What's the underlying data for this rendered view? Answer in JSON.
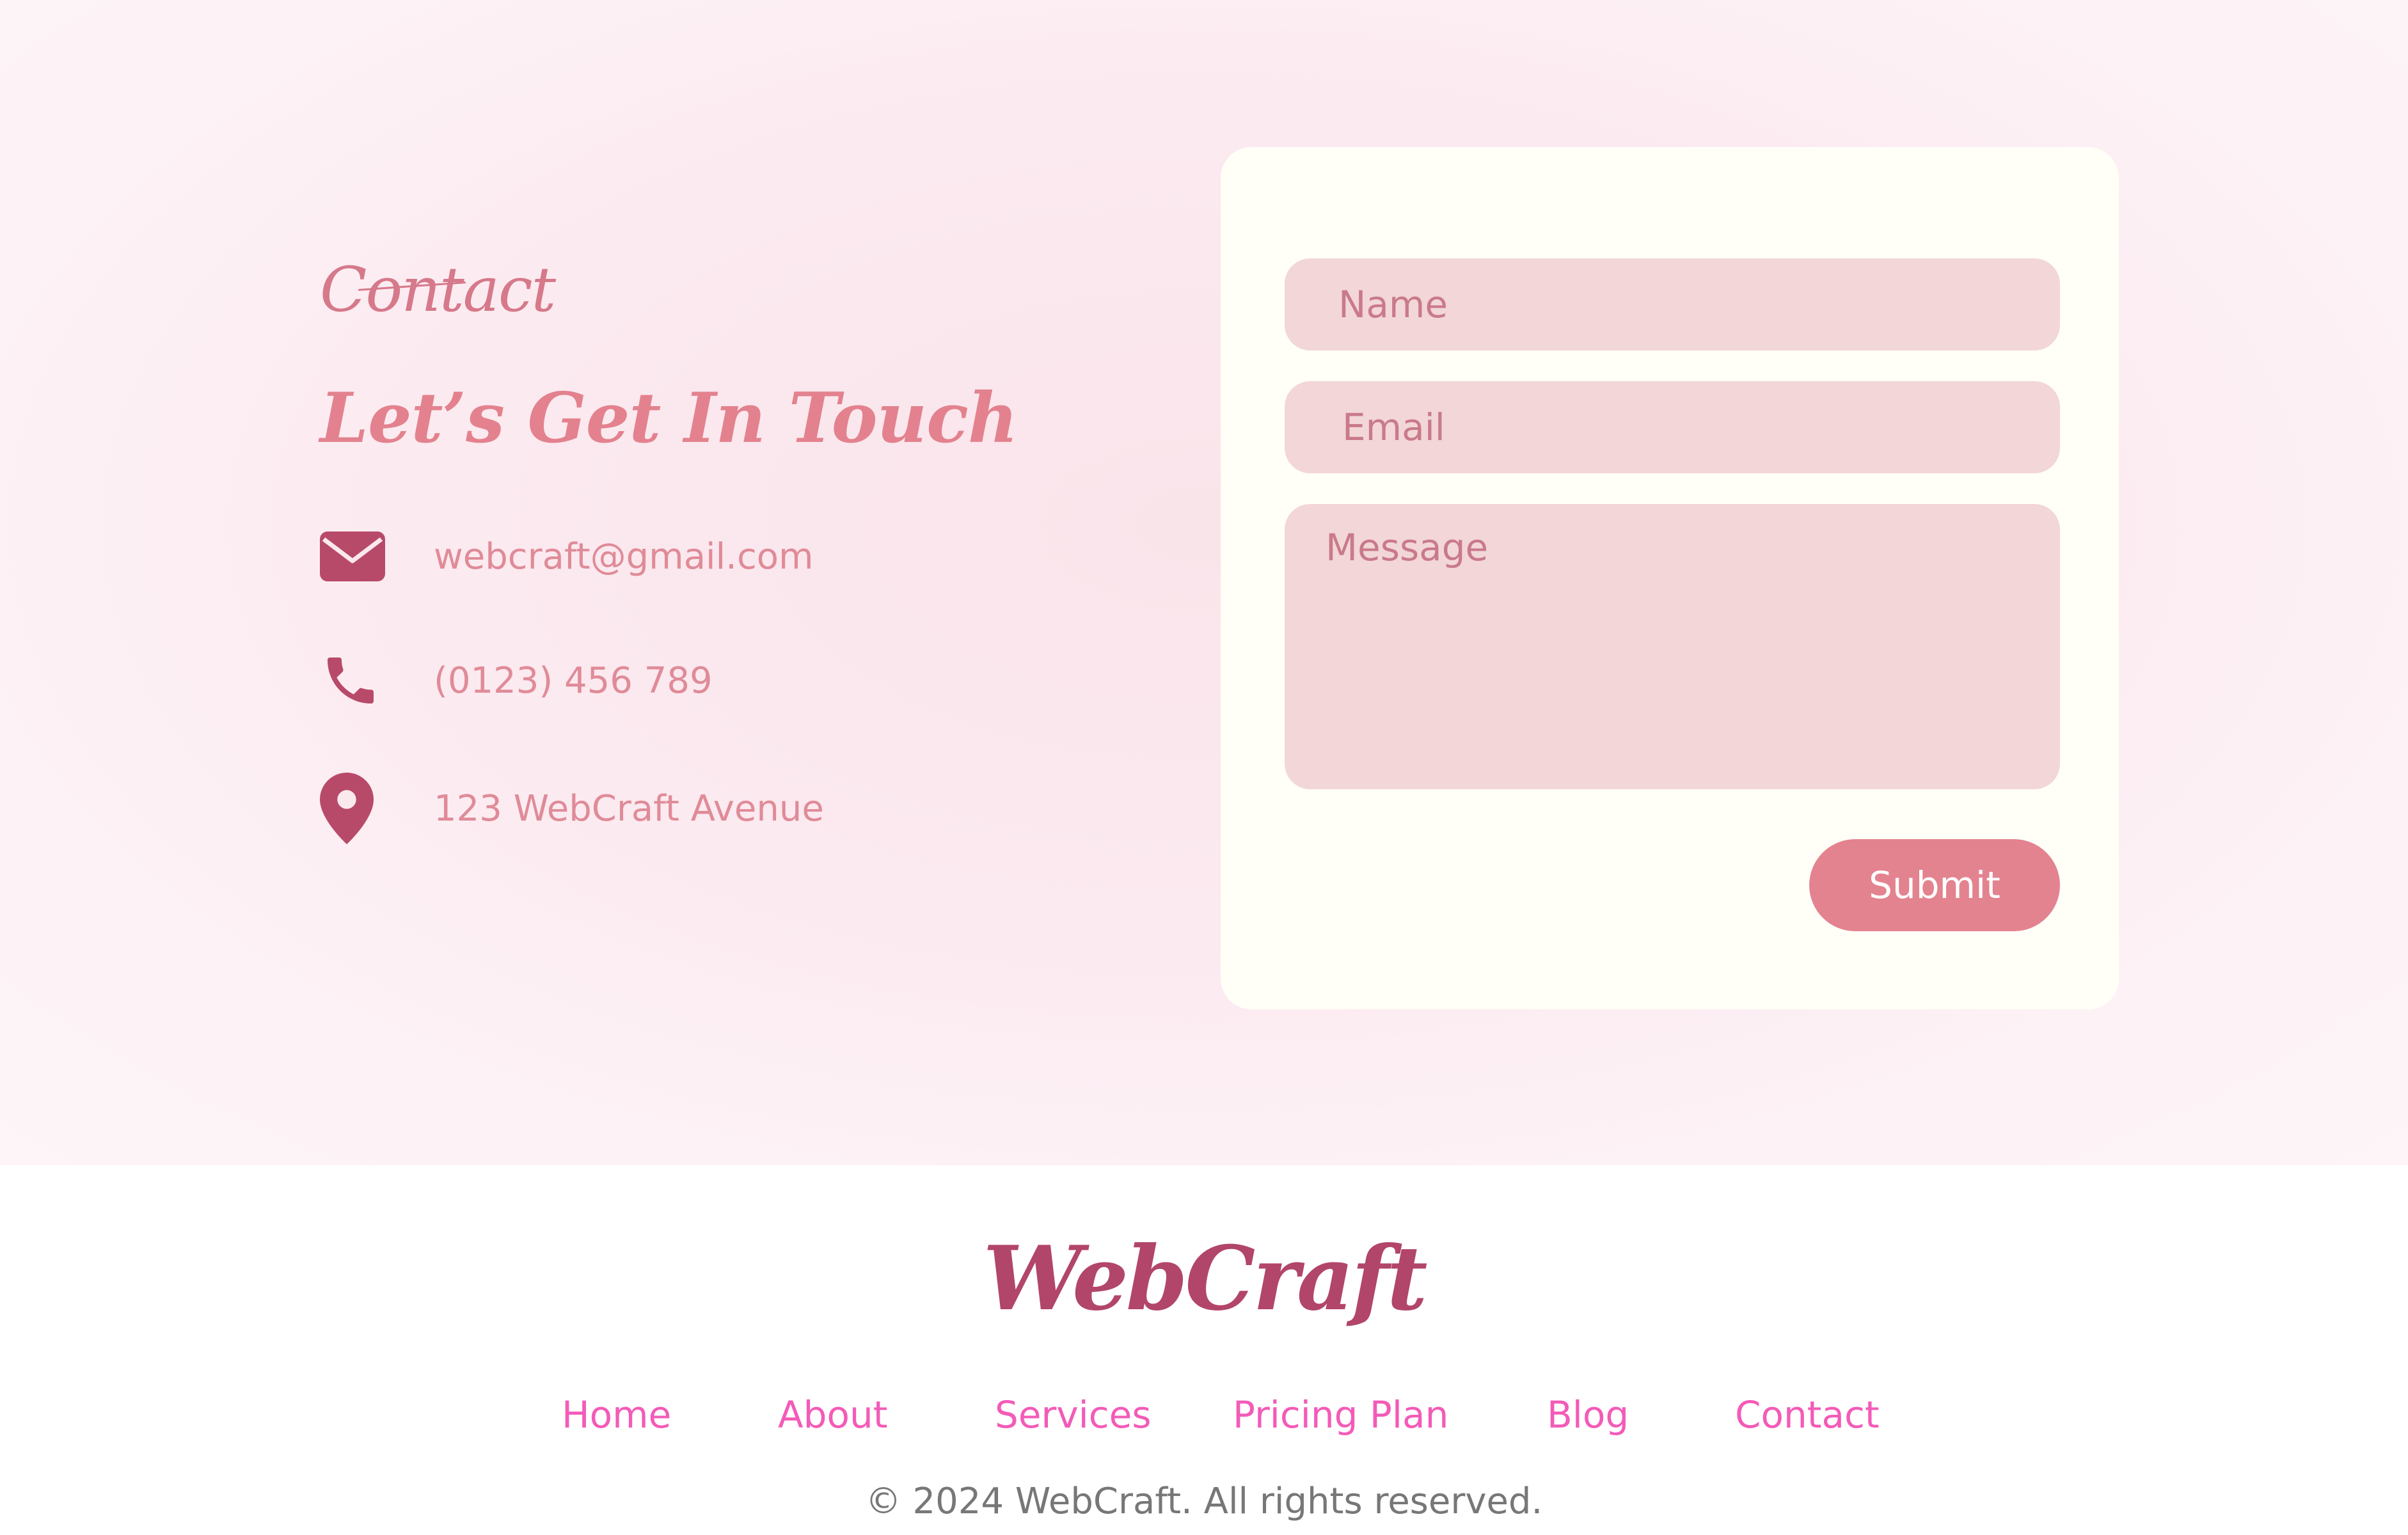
{
  "contact": {
    "eyebrow": "Contact",
    "headline": "Let’s Get In Touch",
    "info": [
      {
        "icon": "envelope-icon",
        "text": "webcraft@gmail.com"
      },
      {
        "icon": "phone-icon",
        "text": "(0123) 456 789"
      },
      {
        "icon": "location-pin-icon",
        "text": "123 WebCraft Avenue"
      }
    ]
  },
  "form": {
    "name_placeholder": "Name",
    "email_placeholder": "Email",
    "message_placeholder": "Message",
    "submit_label": "Submit"
  },
  "footer": {
    "brand": "WebCraft",
    "nav": [
      "Home",
      "About",
      "Services",
      "Pricing Plan",
      "Blog",
      "Contact"
    ],
    "copyright": "© 2024 WebCraft. All rights reserved."
  },
  "colors": {
    "accent": "#e3838f",
    "icon": "#b84a69",
    "brand": "#b2456a",
    "nav_link": "#f35bb8",
    "field_bg": "#f2d6d8",
    "card_bg": "#fffff8"
  }
}
